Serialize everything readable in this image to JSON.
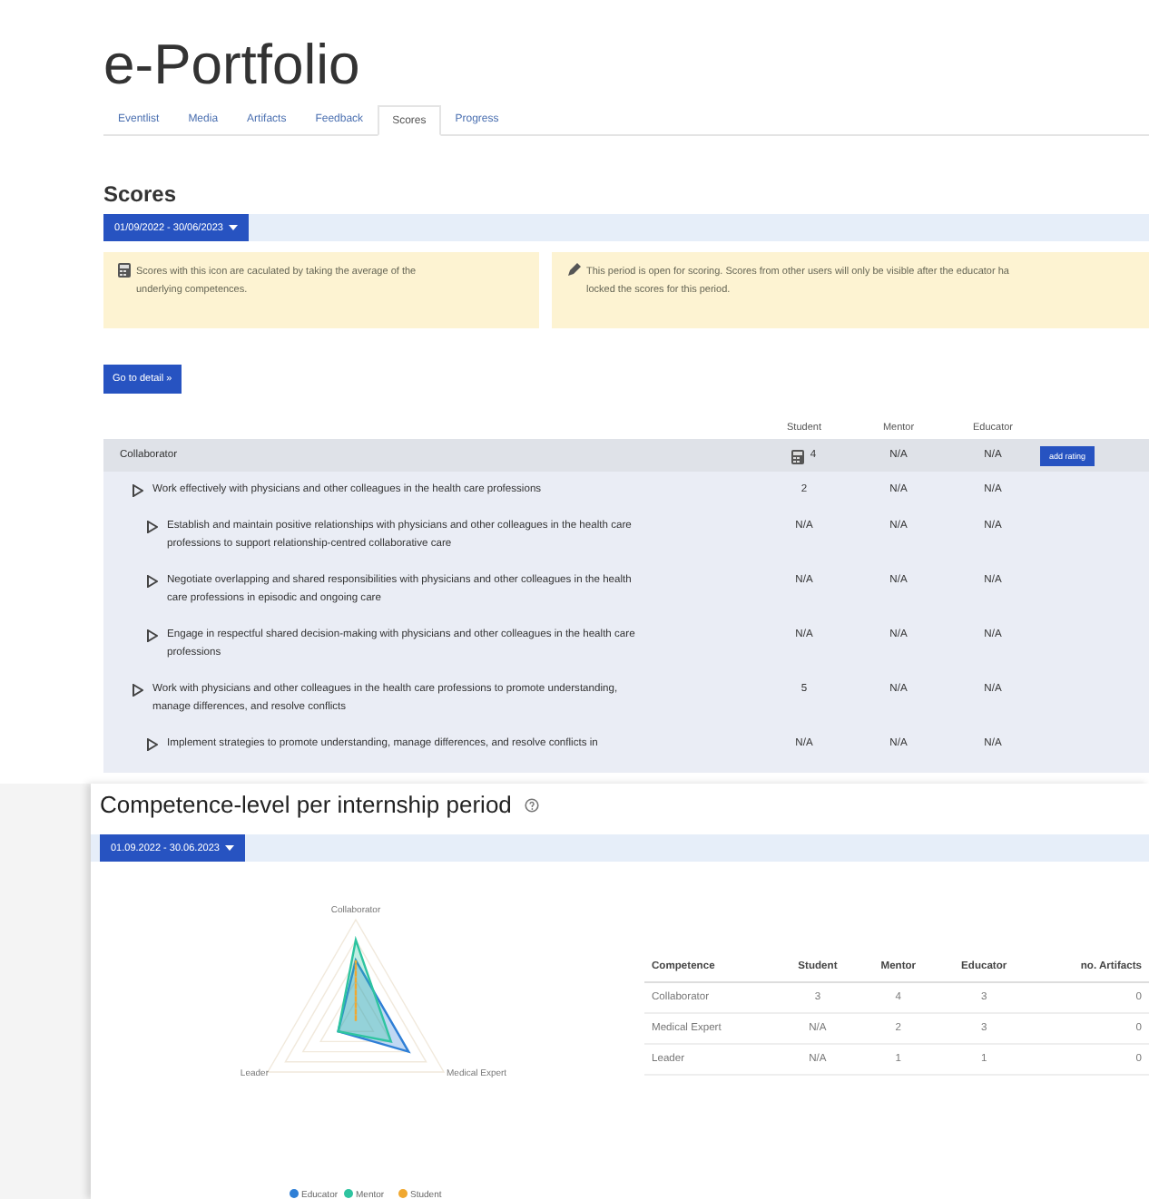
{
  "title": "e-Portfolio",
  "tabs": [
    {
      "label": "Eventlist",
      "selected": false
    },
    {
      "label": "Media",
      "selected": false
    },
    {
      "label": "Artifacts",
      "selected": false
    },
    {
      "label": "Feedback",
      "selected": false
    },
    {
      "label": "Scores",
      "selected": true
    },
    {
      "label": "Progress",
      "selected": false
    }
  ],
  "scores": {
    "heading": "Scores",
    "period": "01/09/2022 - 30/06/2023",
    "alerts": [
      {
        "kind": "calculated",
        "lines": [
          "Scores with this icon are caculated by taking the average of the",
          "underlying competences."
        ]
      },
      {
        "kind": "open",
        "lines": [
          "This period is open for scoring. Scores from other users will only be visible after the educator ha",
          "locked the scores for this period."
        ]
      }
    ],
    "detail_button": "Go to detail »",
    "columns": [
      "Student",
      "Mentor",
      "Educator"
    ],
    "competence": {
      "name": "Collaborator",
      "calculated": true,
      "student": "4",
      "mentor": "N/A",
      "educator": "N/A",
      "action": "add rating"
    },
    "rows": [
      {
        "text": "Work effectively with physicians and other colleagues in the health care professions",
        "student": "2",
        "mentor": "N/A",
        "educator": "N/A",
        "children": [
          {
            "text": "Establish and maintain positive relationships with physicians and other colleagues in the health care professions to support relationship-centred collaborative care",
            "student": "N/A",
            "mentor": "N/A",
            "educator": "N/A"
          },
          {
            "text": "Negotiate overlapping and shared responsibilities with physicians and other colleagues in the health care professions in episodic and ongoing care",
            "student": "N/A",
            "mentor": "N/A",
            "educator": "N/A"
          },
          {
            "text": "Engage in respectful shared decision-making with physicians and other colleagues in the health care professions",
            "student": "N/A",
            "mentor": "N/A",
            "educator": "N/A"
          }
        ]
      },
      {
        "text": "Work with physicians and other colleagues in the health care professions to promote understanding, manage differences, and resolve conflicts",
        "student": "5",
        "mentor": "N/A",
        "educator": "N/A",
        "children": [
          {
            "text": "Implement strategies to promote understanding, manage differences, and resolve conflicts in",
            "student": "N/A",
            "mentor": "N/A",
            "educator": "N/A"
          }
        ]
      }
    ]
  },
  "competence_levels": {
    "heading": "Competence-level per internship period",
    "period": "01.09.2022 - 30.06.2023",
    "radar": {
      "axes": [
        "Collaborator",
        "Leader",
        "Medical Expert"
      ],
      "legend": [
        {
          "name": "Educator",
          "color": "#2f7fd6"
        },
        {
          "name": "Mentor",
          "color": "#2ec4a0"
        },
        {
          "name": "Student",
          "color": "#f0a830"
        }
      ]
    },
    "table": {
      "columns": [
        "Competence",
        "Student",
        "Mentor",
        "Educator",
        "no. Artifacts"
      ],
      "rows": [
        [
          "Collaborator",
          "3",
          "4",
          "3",
          "0"
        ],
        [
          "Medical Expert",
          "N/A",
          "2",
          "3",
          "0"
        ],
        [
          "Leader",
          "N/A",
          "1",
          "1",
          "0"
        ]
      ]
    }
  }
}
